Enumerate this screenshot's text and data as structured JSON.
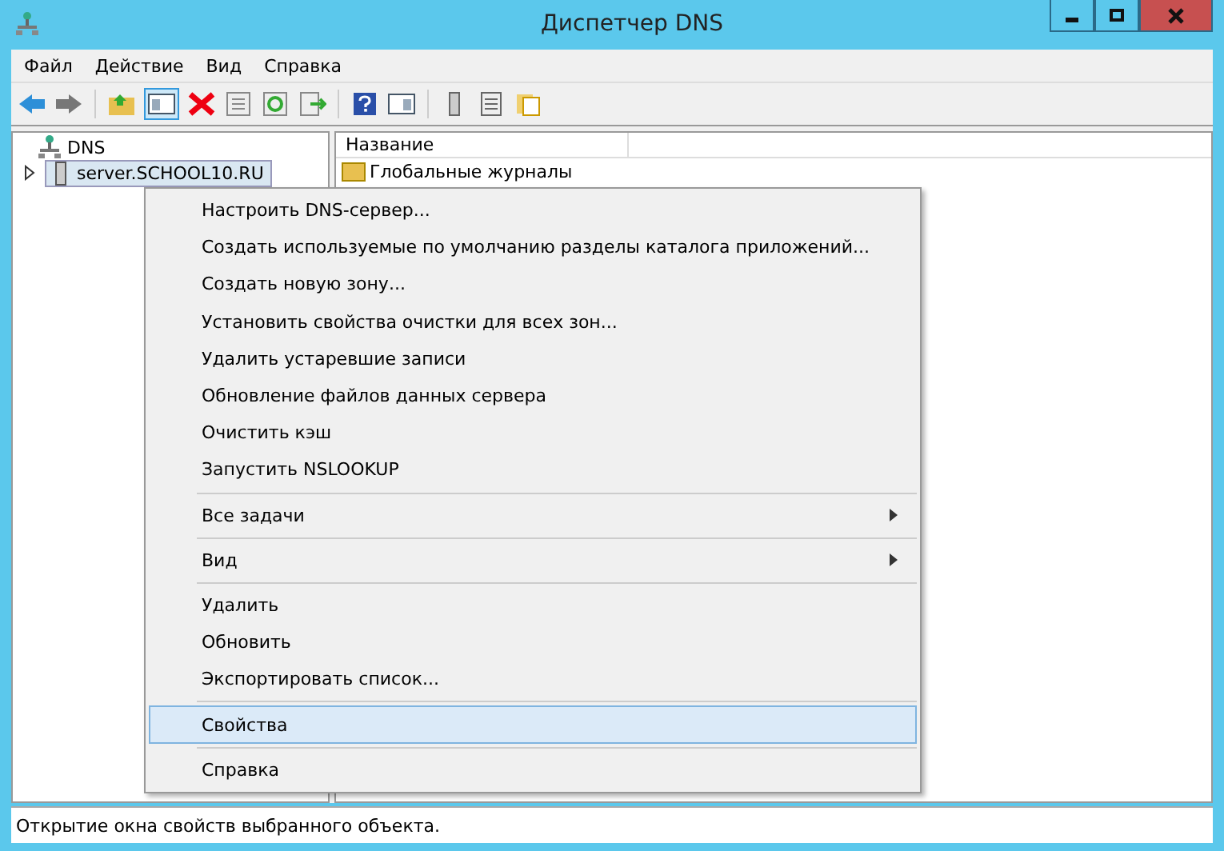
{
  "window": {
    "title": "Диспетчер DNS"
  },
  "menu_bar": [
    "Файл",
    "Действие",
    "Вид",
    "Справка"
  ],
  "tree": {
    "label": "DNS",
    "children": [
      {
        "label": "server.SCHOOL10.RU",
        "selected": true,
        "expanded": false
      }
    ]
  },
  "list": {
    "columns": [
      "Название"
    ],
    "rows": [
      "Глобальные журналы"
    ]
  },
  "context_menu": [
    {
      "kind": "item",
      "label": "Настроить DNS-сервер...",
      "selected": false
    },
    {
      "kind": "item",
      "label": "Создать используемые по умолчанию разделы каталога приложений...",
      "selected": false
    },
    {
      "kind": "item",
      "label": "Создать новую зону...",
      "selected": false
    },
    {
      "kind": "item",
      "label": "Установить свойства очистки для всех зон...",
      "selected": false
    },
    {
      "kind": "item",
      "label": "Удалить устаревшие записи",
      "selected": false
    },
    {
      "kind": "item",
      "label": "Обновление файлов данных сервера",
      "selected": false
    },
    {
      "kind": "item",
      "label": "Очистить кэш",
      "selected": false
    },
    {
      "kind": "item",
      "label": "Запустить NSLOOKUP",
      "selected": false
    },
    {
      "kind": "separator"
    },
    {
      "kind": "submenu",
      "label": "Все задачи",
      "selected": false
    },
    {
      "kind": "separator"
    },
    {
      "kind": "submenu",
      "label": "Вид",
      "selected": false
    },
    {
      "kind": "separator"
    },
    {
      "kind": "item",
      "label": "Удалить",
      "selected": false
    },
    {
      "kind": "item",
      "label": "Обновить",
      "selected": false
    },
    {
      "kind": "item",
      "label": "Экспортировать список...",
      "selected": false
    },
    {
      "kind": "separator"
    },
    {
      "kind": "item",
      "label": "Свойства",
      "selected": true
    },
    {
      "kind": "separator"
    },
    {
      "kind": "item",
      "label": "Справка",
      "selected": false
    }
  ],
  "status_bar": "Открытие окна свойств выбранного объекта."
}
